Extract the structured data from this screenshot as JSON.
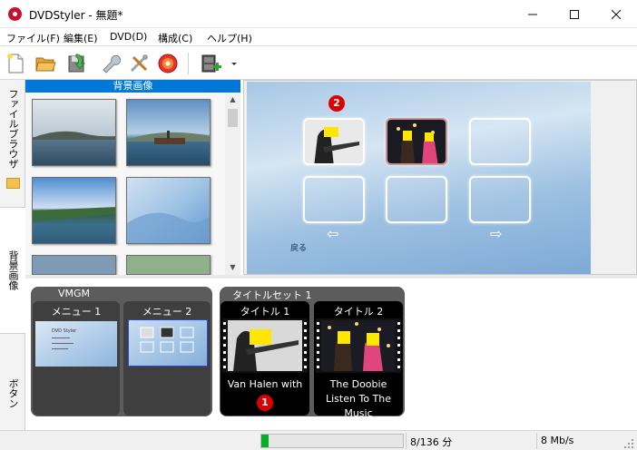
{
  "window": {
    "title": "DVDStyler - 無題*"
  },
  "menu": [
    {
      "label": "ファイル(F)"
    },
    {
      "label": "編集(E)"
    },
    {
      "label": "DVD(D)"
    },
    {
      "label": "構成(C)"
    },
    {
      "label": "ヘルプ(H)"
    }
  ],
  "toolbar": {
    "icons": [
      "new-file-icon",
      "open-folder-icon",
      "save-icon",
      "wrench-icon",
      "settings-tools-icon",
      "burn-disc-icon",
      "add-video-icon",
      "dropdown-arrow-icon"
    ]
  },
  "sidebar": {
    "tabs": [
      {
        "label": "ファイルブラウザ"
      },
      {
        "label": "背景画像"
      },
      {
        "label": "ボタン"
      }
    ]
  },
  "bg_panel": {
    "header": "背景画像",
    "thumbnails": [
      "sea-coast",
      "ship-harbor",
      "lakeshore",
      "blue-wave",
      "blue-gray",
      "green-blur"
    ]
  },
  "menu_editor": {
    "back_label": "戻る",
    "badge": "2"
  },
  "titleset": {
    "vmgm": {
      "label": "VMGM",
      "menus": [
        {
          "title": "メニュー 1",
          "caption": ""
        },
        {
          "title": "メニュー 2",
          "caption": ""
        }
      ]
    },
    "set1": {
      "label": "タイトルセット 1",
      "titles": [
        {
          "title": "タイトル 1",
          "caption": "Van Halen with"
        },
        {
          "title": "タイトル 2",
          "caption": "The Doobie Listen To The Music"
        }
      ]
    },
    "badge": "1",
    "menu1_text": "DVD Styler"
  },
  "status": {
    "progress_fraction": 0.05,
    "duration": "8/136 分",
    "bitrate": "8 Mb/s"
  },
  "colors": {
    "accent": "#0078d7",
    "progress": "#06b025",
    "badge": "#dd0000"
  }
}
